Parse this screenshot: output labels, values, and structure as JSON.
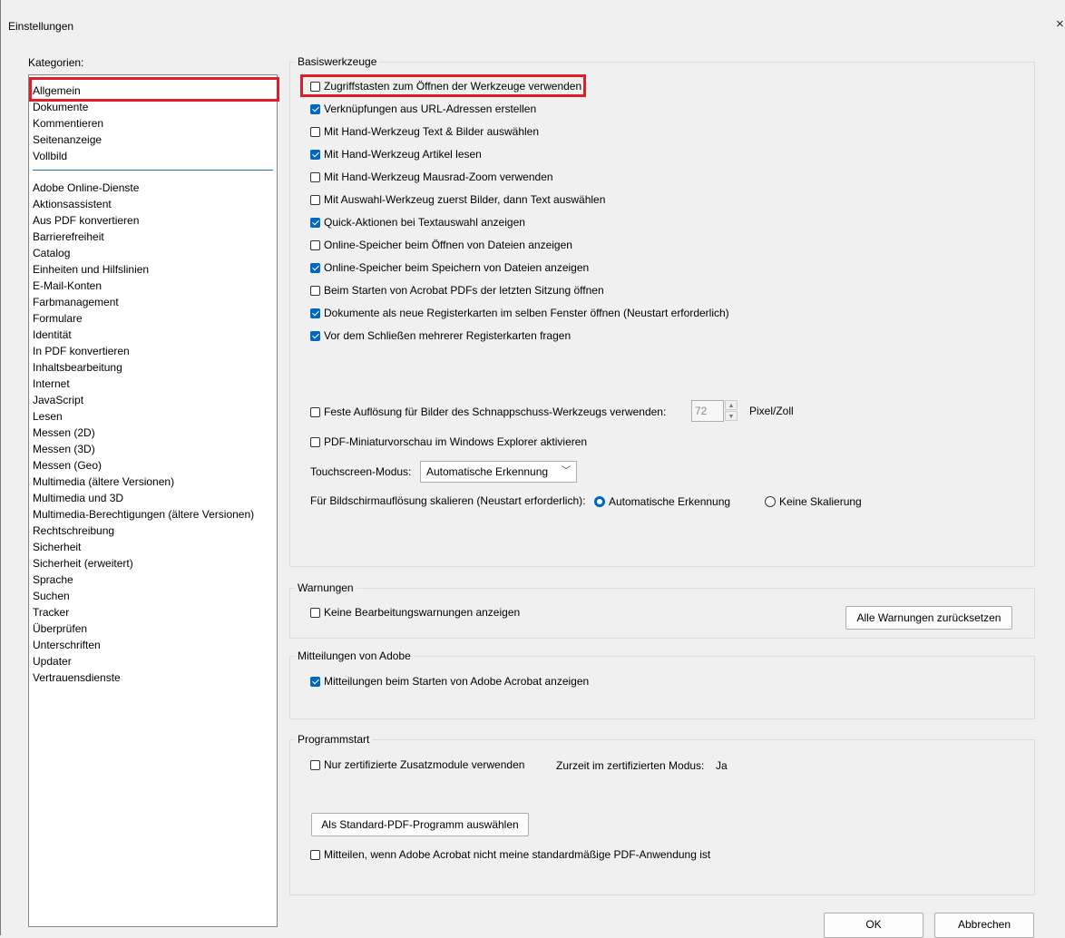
{
  "window": {
    "title": "Einstellungen",
    "close_label": "×"
  },
  "categories": {
    "label": "Kategorien:",
    "selected": "Allgemein",
    "group1": [
      "Allgemein",
      "Dokumente",
      "Kommentieren",
      "Seitenanzeige",
      "Vollbild"
    ],
    "group2": [
      "Adobe Online-Dienste",
      "Aktionsassistent",
      "Aus PDF konvertieren",
      "Barrierefreiheit",
      "Catalog",
      "Einheiten und Hilfslinien",
      "E-Mail-Konten",
      "Farbmanagement",
      "Formulare",
      "Identität",
      "In PDF konvertieren",
      "Inhaltsbearbeitung",
      "Internet",
      "JavaScript",
      "Lesen",
      "Messen (2D)",
      "Messen (3D)",
      "Messen (Geo)",
      "Multimedia (ältere Versionen)",
      "Multimedia und 3D",
      "Multimedia-Berechtigungen (ältere Versionen)",
      "Rechtschreibung",
      "Sicherheit",
      "Sicherheit (erweitert)",
      "Sprache",
      "Suchen",
      "Tracker",
      "Überprüfen",
      "Unterschriften",
      "Updater",
      "Vertrauensdienste"
    ]
  },
  "basis": {
    "title": "Basiswerkzeuge",
    "options": [
      {
        "text": "Zugriffstasten zum Öffnen der Werkzeuge verwenden",
        "checked": false
      },
      {
        "text": "Verknüpfungen aus URL-Adressen erstellen",
        "checked": true
      },
      {
        "text": "Mit Hand-Werkzeug Text & Bilder auswählen",
        "checked": false
      },
      {
        "text": "Mit Hand-Werkzeug Artikel lesen",
        "checked": true
      },
      {
        "text": "Mit Hand-Werkzeug Mausrad-Zoom verwenden",
        "checked": false
      },
      {
        "text": "Mit Auswahl-Werkzeug zuerst Bilder, dann Text auswählen",
        "checked": false
      },
      {
        "text": "Quick-Aktionen bei Textauswahl anzeigen",
        "checked": true
      },
      {
        "text": "Online-Speicher beim Öffnen von Dateien anzeigen",
        "checked": false
      },
      {
        "text": "Online-Speicher beim Speichern von Dateien anzeigen",
        "checked": true
      },
      {
        "text": "Beim Starten von Acrobat PDFs der letzten Sitzung öffnen",
        "checked": false
      },
      {
        "text": "Dokumente als neue Registerkarten im selben Fenster öffnen (Neustart erforderlich)",
        "checked": true
      },
      {
        "text": "Vor dem Schließen mehrerer Registerkarten fragen",
        "checked": true
      }
    ],
    "snapshot_label": "Feste Auflösung für Bilder des Schnappschuss-Werkzeugs verwenden:",
    "snapshot_checked": false,
    "snapshot_value": "72",
    "snapshot_unit": "Pixel/Zoll",
    "thumb_label": "PDF-Miniaturvorschau im Windows Explorer aktivieren",
    "thumb_checked": false,
    "touch_label": "Touchscreen-Modus:",
    "touch_value": "Automatische Erkennung",
    "scale_label": "Für Bildschirmauflösung skalieren (Neustart erforderlich):",
    "scale_auto": "Automatische Erkennung",
    "scale_none": "Keine Skalierung",
    "scale_selected": "auto"
  },
  "warnings": {
    "title": "Warnungen",
    "option": "Keine Bearbeitungswarnungen anzeigen",
    "checked": false,
    "reset_button": "Alle Warnungen zurücksetzen"
  },
  "adobe": {
    "title": "Mitteilungen von Adobe",
    "option": "Mitteilungen beim Starten von Adobe Acrobat anzeigen",
    "checked": true
  },
  "start": {
    "title": "Programmstart",
    "certified_option": "Nur zertifizierte Zusatzmodule verwenden",
    "certified_checked": false,
    "current_mode_label": "Zurzeit im zertifizierten Modus:",
    "current_mode_value": "Ja",
    "default_button": "Als Standard-PDF-Programm auswählen",
    "notify_option": "Mitteilen, wenn Adobe Acrobat nicht meine standardmäßige PDF-Anwendung ist",
    "notify_checked": false
  },
  "footer": {
    "ok": "OK",
    "cancel": "Abbrechen"
  },
  "colors": {
    "accent": "#0067c0",
    "highlight": "#e01e26"
  }
}
